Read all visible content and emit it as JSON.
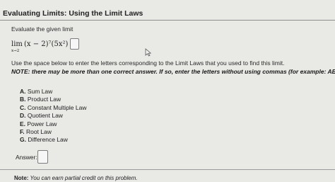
{
  "header": {
    "title": "Evaluating Limits: Using the Limit Laws"
  },
  "question": {
    "instruction": "Evaluate the given limit",
    "limit_word": "lim",
    "limit_subscript": "x→2",
    "expression": "(x − 2)⁷(5x²) =",
    "paragraph": "Use the space below to enter the letters corresponding to the Limit Laws that you used to find this limit.",
    "note_label": "NOTE:",
    "note_text": " there may be more than one correct answer. If so, enter the letters without using commas (for example: ABD).",
    "options": [
      {
        "key": "A.",
        "label": " Sum Law"
      },
      {
        "key": "B.",
        "label": " Product Law"
      },
      {
        "key": "C.",
        "label": " Constant Multiple Law"
      },
      {
        "key": "D.",
        "label": " Quotient Law"
      },
      {
        "key": "E.",
        "label": " Power Law"
      },
      {
        "key": "F.",
        "label": " Root Law"
      },
      {
        "key": "G.",
        "label": " Difference Law"
      }
    ],
    "answer_label": "Answer:"
  },
  "footer": {
    "note_label": "Note:",
    "note_text": " You can earn partial credit on this problem."
  },
  "icons": {
    "cursor": "mouse-pointer-icon"
  }
}
